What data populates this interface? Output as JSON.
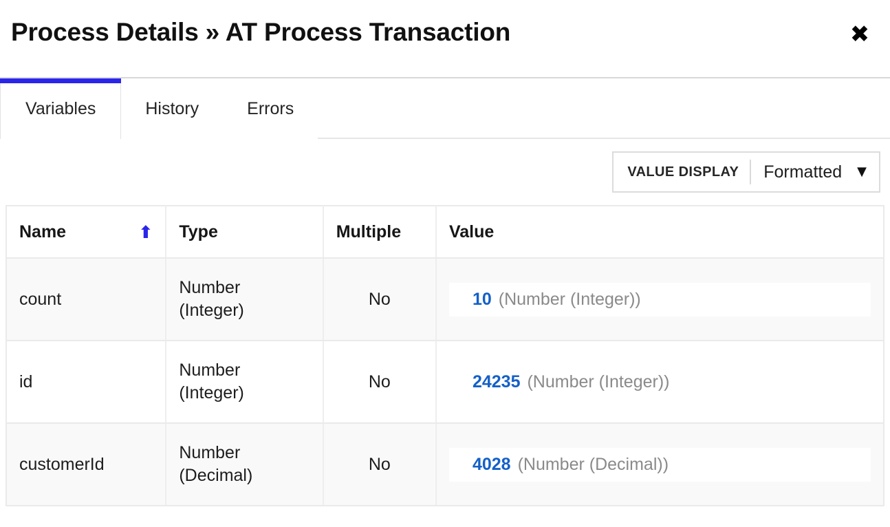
{
  "header": {
    "title": "Process Details » AT Process Transaction",
    "close_label": "✖",
    "close_icon": "close-icon"
  },
  "tabs": [
    {
      "label": "Variables",
      "active": true
    },
    {
      "label": "History",
      "active": false
    },
    {
      "label": "Errors",
      "active": false
    }
  ],
  "toolbar": {
    "value_display_label": "VALUE DISPLAY",
    "value_display_selected": "Formatted",
    "caret_icon": "▼"
  },
  "table": {
    "columns": [
      "Name",
      "Type",
      "Multiple",
      "Value"
    ],
    "sort": {
      "column": "Name",
      "direction": "asc",
      "icon": "⬆"
    },
    "rows": [
      {
        "name": "count",
        "type": "Number\n(Integer)",
        "multiple": "No",
        "value_number": "10",
        "value_type": "(Number (Integer))",
        "shaded": true
      },
      {
        "name": "id",
        "type": "Number\n(Integer)",
        "multiple": "No",
        "value_number": "24235",
        "value_type": "(Number (Integer))",
        "shaded": false
      },
      {
        "name": "customerId",
        "type": "Number\n(Decimal)",
        "multiple": "No",
        "value_number": "4028",
        "value_type": "(Number (Decimal))",
        "shaded": true
      }
    ]
  },
  "colors": {
    "accent_blue": "#2b25ea",
    "value_blue": "#1460c8",
    "muted_gray": "#8a8a8a",
    "border": "#eaeaea"
  }
}
